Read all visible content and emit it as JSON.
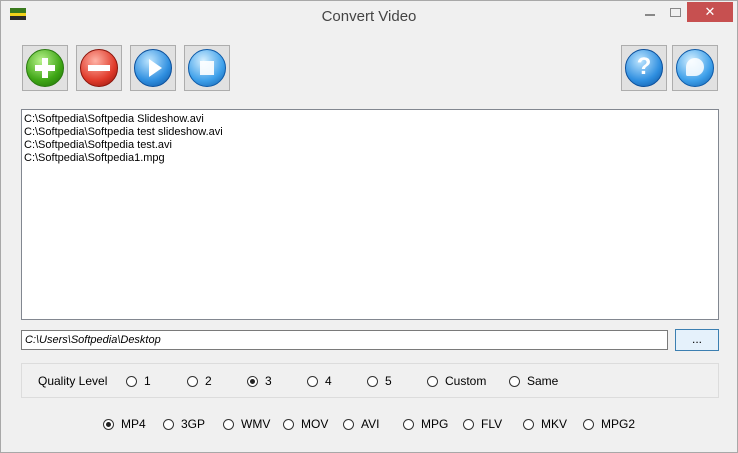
{
  "window": {
    "title": "Convert Video",
    "min_glyph": "",
    "max_glyph": "",
    "close_glyph": "✕"
  },
  "toolbar": {
    "help_glyph": "?"
  },
  "files": [
    "C:\\Softpedia\\Softpedia Slideshow.avi",
    "C:\\Softpedia\\Softpedia test slideshow.avi",
    "C:\\Softpedia\\Softpedia test.avi",
    "C:\\Softpedia\\Softpedia1.mpg"
  ],
  "output": {
    "path": "C:\\Users\\Softpedia\\Desktop",
    "browse_label": "..."
  },
  "quality": {
    "label": "Quality Level",
    "options": [
      "1",
      "2",
      "3",
      "4",
      "5",
      "Custom",
      "Same"
    ],
    "selected": "3"
  },
  "formats": {
    "options": [
      "MP4",
      "3GP",
      "WMV",
      "MOV",
      "AVI",
      "MPG",
      "FLV",
      "MKV",
      "MPG2"
    ],
    "selected": "MP4"
  }
}
